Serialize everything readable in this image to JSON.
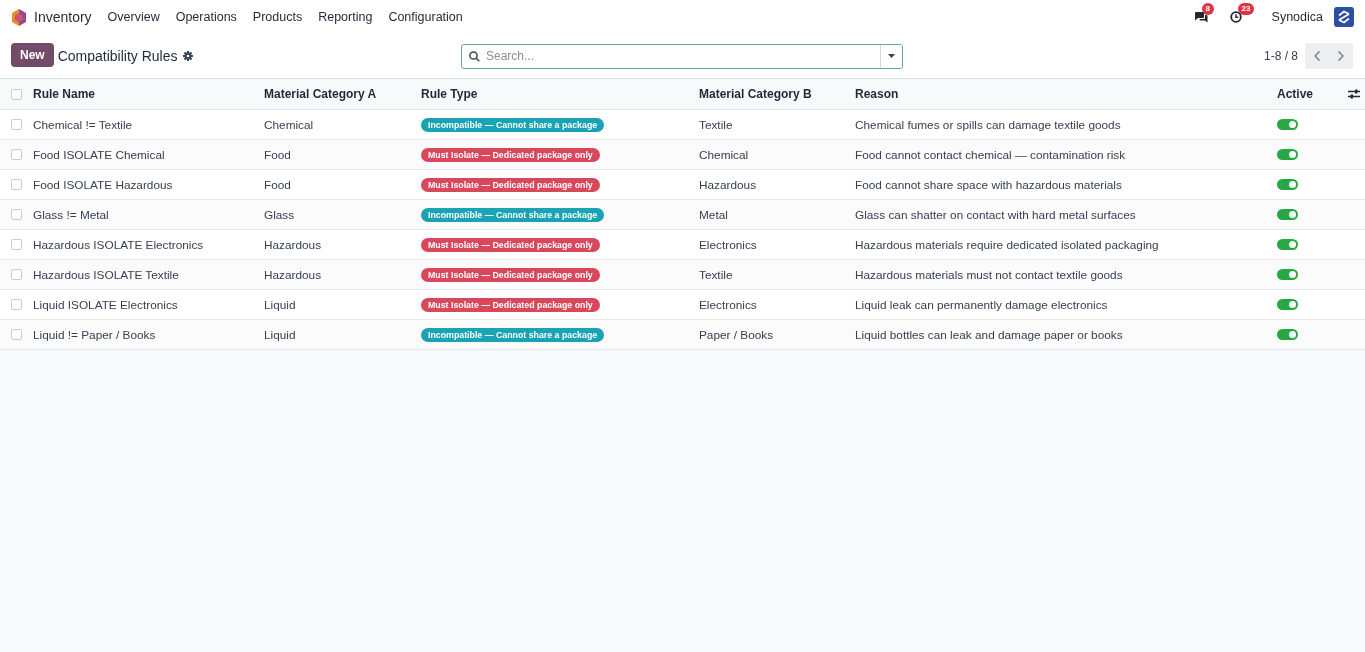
{
  "navbar": {
    "app_name": "Inventory",
    "menu": [
      "Overview",
      "Operations",
      "Products",
      "Reporting",
      "Configuration"
    ],
    "messages_count": "8",
    "activities_count": "23",
    "company": "Synodica"
  },
  "control_panel": {
    "new_button": "New",
    "title": "Compatibility Rules",
    "search": {
      "placeholder": "Search..."
    },
    "pager": "1-8 / 8"
  },
  "table": {
    "all_selected": false,
    "columns": [
      "Rule Name",
      "Material Category A",
      "Rule Type",
      "Material Category B",
      "Reason",
      "Active"
    ],
    "rows": [
      {
        "selected": false,
        "name": "Chemical != Textile",
        "category_a": "Chemical",
        "rule_type": {
          "label": "Incompatible — Cannot share a package",
          "color": "#1aa3b4"
        },
        "category_b": "Textile",
        "reason": "Chemical fumes or spills can damage textile goods",
        "active": true
      },
      {
        "selected": false,
        "name": "Food ISOLATE Chemical",
        "category_a": "Food",
        "rule_type": {
          "label": "Must Isolate — Dedicated package only",
          "color": "#d9485a"
        },
        "category_b": "Chemical",
        "reason": "Food cannot contact chemical — contamination risk",
        "active": true
      },
      {
        "selected": false,
        "name": "Food ISOLATE Hazardous",
        "category_a": "Food",
        "rule_type": {
          "label": "Must Isolate — Dedicated package only",
          "color": "#d9485a"
        },
        "category_b": "Hazardous",
        "reason": "Food cannot share space with hazardous materials",
        "active": true
      },
      {
        "selected": false,
        "name": "Glass != Metal",
        "category_a": "Glass",
        "rule_type": {
          "label": "Incompatible — Cannot share a package",
          "color": "#1aa3b4"
        },
        "category_b": "Metal",
        "reason": "Glass can shatter on contact with hard metal surfaces",
        "active": true
      },
      {
        "selected": false,
        "name": "Hazardous ISOLATE Electronics",
        "category_a": "Hazardous",
        "rule_type": {
          "label": "Must Isolate — Dedicated package only",
          "color": "#d9485a"
        },
        "category_b": "Electronics",
        "reason": "Hazardous materials require dedicated isolated packaging",
        "active": true
      },
      {
        "selected": false,
        "name": "Hazardous ISOLATE Textile",
        "category_a": "Hazardous",
        "rule_type": {
          "label": "Must Isolate — Dedicated package only",
          "color": "#d9485a"
        },
        "category_b": "Textile",
        "reason": "Hazardous materials must not contact textile goods",
        "active": true
      },
      {
        "selected": false,
        "name": "Liquid ISOLATE Electronics",
        "category_a": "Liquid",
        "rule_type": {
          "label": "Must Isolate — Dedicated package only",
          "color": "#d9485a"
        },
        "category_b": "Electronics",
        "reason": "Liquid leak can permanently damage electronics",
        "active": true
      },
      {
        "selected": false,
        "name": "Liquid != Paper / Books",
        "category_a": "Liquid",
        "rule_type": {
          "label": "Incompatible — Cannot share a package",
          "color": "#1aa3b4"
        },
        "category_b": "Paper / Books",
        "reason": "Liquid bottles can leak and damage paper or books",
        "active": true
      }
    ]
  }
}
